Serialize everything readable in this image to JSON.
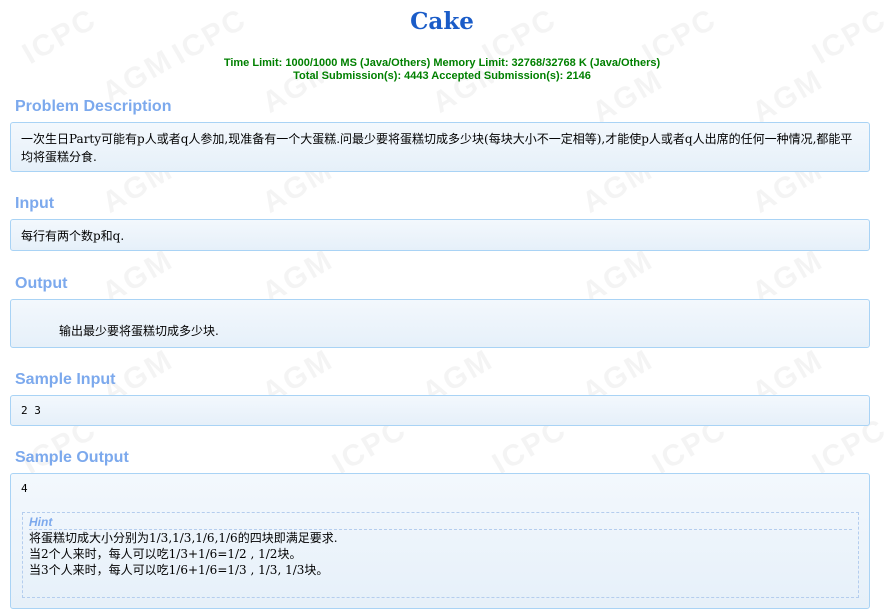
{
  "title": "Cake",
  "limits": {
    "line1": "Time Limit: 1000/1000 MS (Java/Others)    Memory Limit: 32768/32768 K (Java/Others)",
    "line2": "Total Submission(s): 4443    Accepted Submission(s): 2146"
  },
  "sections": {
    "description": {
      "heading": "Problem Description",
      "text": "一次生日Party可能有p人或者q人参加,现准备有一个大蛋糕.问最少要将蛋糕切成多少块(每块大小不一定相等),才能使p人或者q人出席的任何一种情况,都能平均将蛋糕分食."
    },
    "input": {
      "heading": "Input",
      "text": "每行有两个数p和q."
    },
    "output": {
      "heading": "Output",
      "text": "输出最少要将蛋糕切成多少块."
    },
    "sample_input": {
      "heading": "Sample Input",
      "text": "2 3"
    },
    "sample_output": {
      "heading": "Sample Output",
      "text": "4"
    }
  },
  "hint": {
    "title": "Hint",
    "lines": [
      "将蛋糕切成大小分别为1/3,1/3,1/6,1/6的四块即满足要求.",
      "当2个人来时，每人可以吃1/3+1/6=1/2 , 1/2块。",
      "当3个人来时，每人可以吃1/6+1/6=1/3 , 1/3, 1/3块。"
    ]
  },
  "watermark": "ACM ICPC",
  "colors": {
    "title": "#1a5cc8",
    "limits": "#008000",
    "section_heading": "#7ca9ed",
    "panel_border": "#a9d3f5"
  }
}
